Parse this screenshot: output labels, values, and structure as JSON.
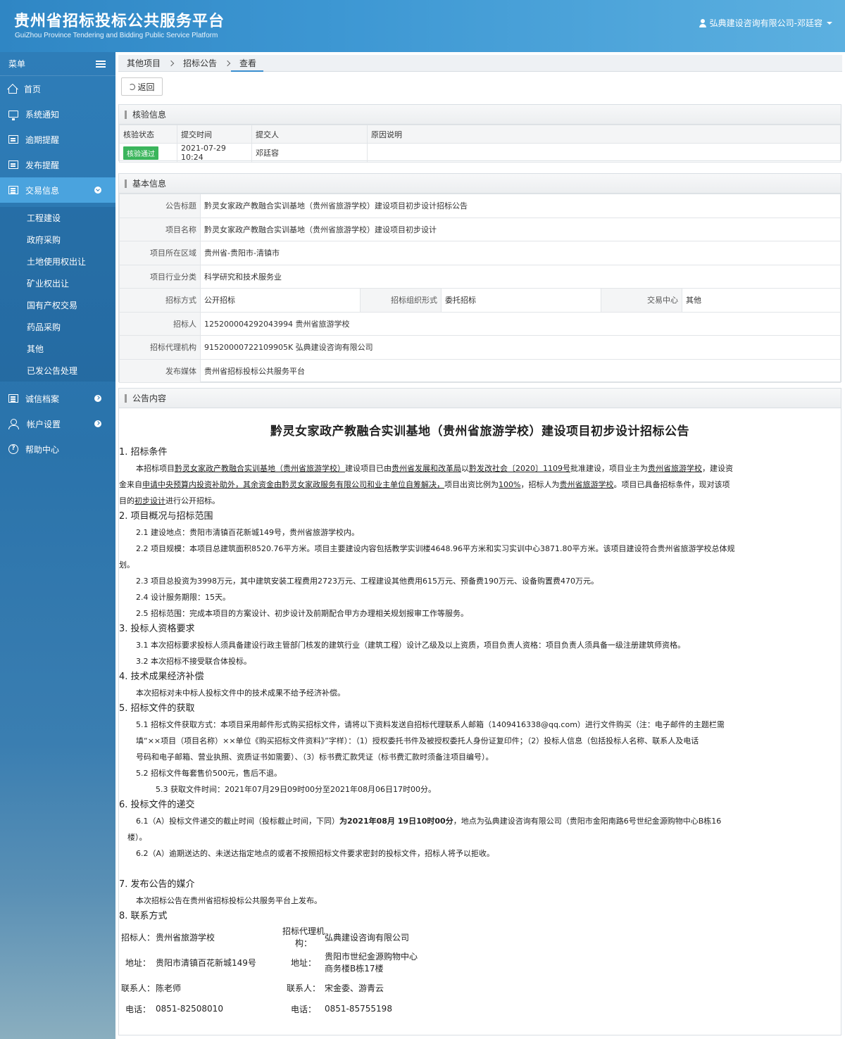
{
  "header": {
    "title": "贵州省招标投标公共服务平台",
    "subtitle": "GuiZhou Province Tendering and Bidding Public Service Platform",
    "user": "弘典建设咨询有限公司-邓廷容"
  },
  "sidebar": {
    "menu_label": "菜单",
    "items": [
      {
        "label": "首页"
      },
      {
        "label": "系统通知"
      },
      {
        "label": "逾期提醒"
      },
      {
        "label": "发布提醒"
      },
      {
        "label": "交易信息"
      },
      {
        "label": "诚信档案"
      },
      {
        "label": "帐户设置"
      },
      {
        "label": "帮助中心"
      }
    ],
    "sub_items": [
      "工程建设",
      "政府采购",
      "土地使用权出让",
      "矿业权出让",
      "国有产权交易",
      "药品采购",
      "其他",
      "已发公告处理"
    ]
  },
  "breadcrumb": [
    "其他项目",
    "招标公告",
    "查看"
  ],
  "back_label": "返回",
  "verify": {
    "heading": "核验信息",
    "columns": [
      "核验状态",
      "提交时间",
      "提交人",
      "原因说明"
    ],
    "status": "核验通过",
    "time": "2021-07-29 10:24",
    "submitter": "邓廷容",
    "reason": ""
  },
  "basic": {
    "heading": "基本信息",
    "rows": {
      "title_label": "公告标题",
      "title": "黔灵女家政产教融合实训基地（贵州省旅游学校）建设项目初步设计招标公告",
      "project_label": "项目名称",
      "project": "黔灵女家政产教融合实训基地（贵州省旅游学校）建设项目初步设计",
      "region_label": "项目所在区域",
      "region": "贵州省-贵阳市-清镇市",
      "industry_label": "项目行业分类",
      "industry": "科学研究和技术服务业",
      "method_label": "招标方式",
      "method": "公开招标",
      "org_form_label": "招标组织形式",
      "org_form": "委托招标",
      "center_label": "交易中心",
      "center": "其他",
      "tenderer_label": "招标人",
      "tenderer": "125200004292043994 贵州省旅游学校",
      "agency_label": "招标代理机构",
      "agency": "91520000722109905K 弘典建设咨询有限公司",
      "media_label": "发布媒体",
      "media": "贵州省招标投标公共服务平台"
    }
  },
  "content": {
    "heading": "公告内容",
    "doc_title": "黔灵女家政产教融合实训基地（贵州省旅游学校）建设项目初步设计招标公告",
    "s1": "1.  招标条件",
    "s1_p1a": "本招标项目",
    "s1_p1b": "黔灵女家政产教融合实训基地（贵州省旅游学校）",
    "s1_p1c": "建设项目已由",
    "s1_p1d": "贵州省发展和改革局",
    "s1_p1e": "以",
    "s1_p1f": "黔发改社会〔2020〕1109号",
    "s1_p1g": "批准建设，项目业主为",
    "s1_p1h": "贵州省旅游学校",
    "s1_p1i": "，建设资",
    "s1_p2a": "金来自",
    "s1_p2b": "申请中央预算内投资补助外，其余资金由黔灵女家政服务有限公司和业主单位自筹解决，",
    "s1_p2c": "项目出资比例为",
    "s1_p2d": "100%",
    "s1_p2e": "，招标人为",
    "s1_p2f": "贵州省旅游学校",
    "s1_p2g": "。项目已具备招标条件，现对该项",
    "s1_p3a": "目的",
    "s1_p3b": "初步设计",
    "s1_p3c": "进行公开招标。",
    "s2": "2.  项目概况与招标范围",
    "s2_1": "2.1   建设地点：贵阳市清镇百花新城149号，贵州省旅游学校内。",
    "s2_2a": "2.2   项目规模：本项目总建筑面积8520.76平方米。项目主要建设内容包括教学实训楼4648.96平方米和实习实训中心3871.80平方米。该项目建设符合贵州省旅游学校总体规",
    "s2_2b": "划。",
    "s2_3": "2.3    项目总投资为3998万元，其中建筑安装工程费用2723万元、工程建设其他费用615万元、预备费190万元、设备购置费470万元。",
    "s2_4": "2.4   设计服务期限：15天。",
    "s2_5": "2.5   招标范围：完成本项目的方案设计、初步设计及前期配合甲方办理相关规划报审工作等服务。",
    "s3": "3.  投标人资格要求",
    "s3_1": "3.1   本次招标要求投标人须具备建设行政主管部门核发的建筑行业（建筑工程）设计乙级及以上资质，项目负责人资格：项目负责人须具备一级注册建筑师资格。",
    "s3_2": "3.2   本次招标不接受联合体投标。",
    "s4": "4.  技术成果经济补偿",
    "s4_p": "本次招标对未中标人投标文件中的技术成果不给予经济补偿。",
    "s5": "5.  招标文件的获取",
    "s5_1a": "5.1   招标文件获取方式：本项目采用邮件形式购买招标文件，请将以下资料发送自招标代理联系人邮箱（1409416338@qq.com）进行文件购买（注：电子邮件的主题栏需",
    "s5_1b": "填“××项目（项目名称）××单位《购买招标文件资料》”字样）：（1）授权委托书件及被授权委托人身份证复印件；（2）投标人信息（包括投标人名称、联系人及电话",
    "s5_1c": "号码和电子邮箱、营业执照、资质证书如需要）、（3）标书费汇款凭证（标书费汇款时须备注项目编号）。",
    "s5_2": "5.2   招标文件每套售价500元，售后不退。",
    "s5_3": "5.3    获取文件时间：2021年07月29日09时00分至2021年08月06日17时00分。",
    "s6": "6.  投标文件的递交",
    "s6_1a": "6.1（A）投标文件递交的截止时间（投标截止时间，下同）",
    "s6_1b": "为2021年08月 19日10时00分",
    "s6_1c": "，地点为弘典建设咨询有限公司（贵阳市金阳南路6号世纪金源购物中心B栋16",
    "s6_1d": "楼）。",
    "s6_2": "6.2（A）逾期送达的、未送达指定地点的或者不按照招标文件要求密封的投标文件，招标人将予以拒收。",
    "s7": "7.  发布公告的媒介",
    "s7_p": "本次招标公告在贵州省招标投标公共服务平台上发布。",
    "s8": "8.  联系方式",
    "contact": {
      "l_tenderer": "招标人：",
      "tenderer": "贵州省旅游学校",
      "l_agency": "招标代理机构：",
      "agency": "弘典建设咨询有限公司",
      "l_addr": "地址：",
      "addr": "贵阳市清镇百花新城149号",
      "l_addr2": "地址：",
      "addr2": "贵阳市世纪金源购物中心商务楼B栋17楼",
      "l_person": "联系人：",
      "person": "陈老师",
      "l_person2": "联系人：",
      "person2": "宋金委、游青云",
      "l_tel": "电话：",
      "tel": "0851-82508010",
      "l_tel2": "电话：",
      "tel2": "0851-85755198"
    }
  }
}
